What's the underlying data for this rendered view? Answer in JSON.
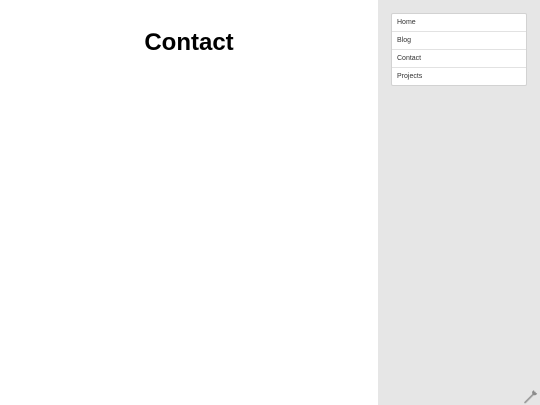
{
  "page": {
    "title": "Contact"
  },
  "sidebar": {
    "items": [
      {
        "label": "Home"
      },
      {
        "label": "Blog"
      },
      {
        "label": "Contact"
      },
      {
        "label": "Projects"
      }
    ]
  },
  "icons": {
    "corner_tool": "wrench-icon"
  },
  "colors": {
    "sidebar_bg": "#e6e6e6",
    "nav_bg": "#ffffff",
    "nav_border": "#d2d2d2",
    "title_text": "#000000"
  }
}
